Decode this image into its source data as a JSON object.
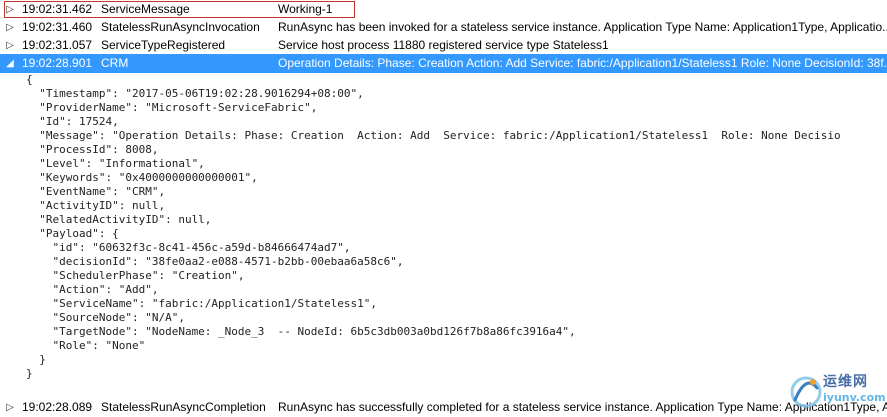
{
  "events": [
    {
      "time": "19:02:31.462",
      "event": "ServiceMessage",
      "message": "Working-1",
      "expanded": false,
      "highlighted": true
    },
    {
      "time": "19:02:31.460",
      "event": "StatelessRunAsyncInvocation",
      "message": "RunAsync has been invoked for a stateless service instance.  Application Type Name: Application1Type, Applicatio...",
      "expanded": false
    },
    {
      "time": "19:02:31.057",
      "event": "ServiceTypeRegistered",
      "message": "Service host process 11880 registered service type Stateless1",
      "expanded": false
    },
    {
      "time": "19:02:28.901",
      "event": "CRM",
      "message": "Operation Details: Phase: Creation  Action: Add  Service: fabric:/Application1/Stateless1  Role: None DecisionId: 38f...",
      "expanded": true,
      "selected": true
    },
    {
      "time": "19:02:28.089",
      "event": "StatelessRunAsyncCompletion",
      "message": "RunAsync has successfully completed for a stateless service instance.  Application Type Name: Application1Type, Ap",
      "expanded": false
    }
  ],
  "detail_lines": [
    "{",
    "  \"Timestamp\": \"2017-05-06T19:02:28.9016294+08:00\",",
    "  \"ProviderName\": \"Microsoft-ServiceFabric\",",
    "  \"Id\": 17524,",
    "  \"Message\": \"Operation Details: Phase: Creation  Action: Add  Service: fabric:/Application1/Stateless1  Role: None Decisio",
    "  \"ProcessId\": 8008,",
    "  \"Level\": \"Informational\",",
    "  \"Keywords\": \"0x4000000000000001\",",
    "  \"EventName\": \"CRM\",",
    "  \"ActivityID\": null,",
    "  \"RelatedActivityID\": null,",
    "  \"Payload\": {",
    "    \"id\": \"60632f3c-8c41-456c-a59d-b84666474ad7\",",
    "    \"decisionId\": \"38fe0aa2-e088-4571-b2bb-00ebaa6a58c6\",",
    "    \"SchedulerPhase\": \"Creation\",",
    "    \"Action\": \"Add\",",
    "    \"ServiceName\": \"fabric:/Application1/Stateless1\",",
    "    \"SourceNode\": \"N/A\",",
    "    \"TargetNode\": \"NodeName: _Node_3  -- NodeId: 6b5c3db003a0bd126f7b8a86fc3916a4\",",
    "    \"Role\": \"None\"",
    "  }",
    "}"
  ],
  "watermark": {
    "chinese": "运维网",
    "url": "iyunv.com"
  },
  "icons": {
    "collapsed": "triangle-right-outline",
    "expanded": "triangle-down-filled"
  },
  "colors": {
    "selected_bg": "#3399ff",
    "highlight_border": "#c0392b"
  }
}
